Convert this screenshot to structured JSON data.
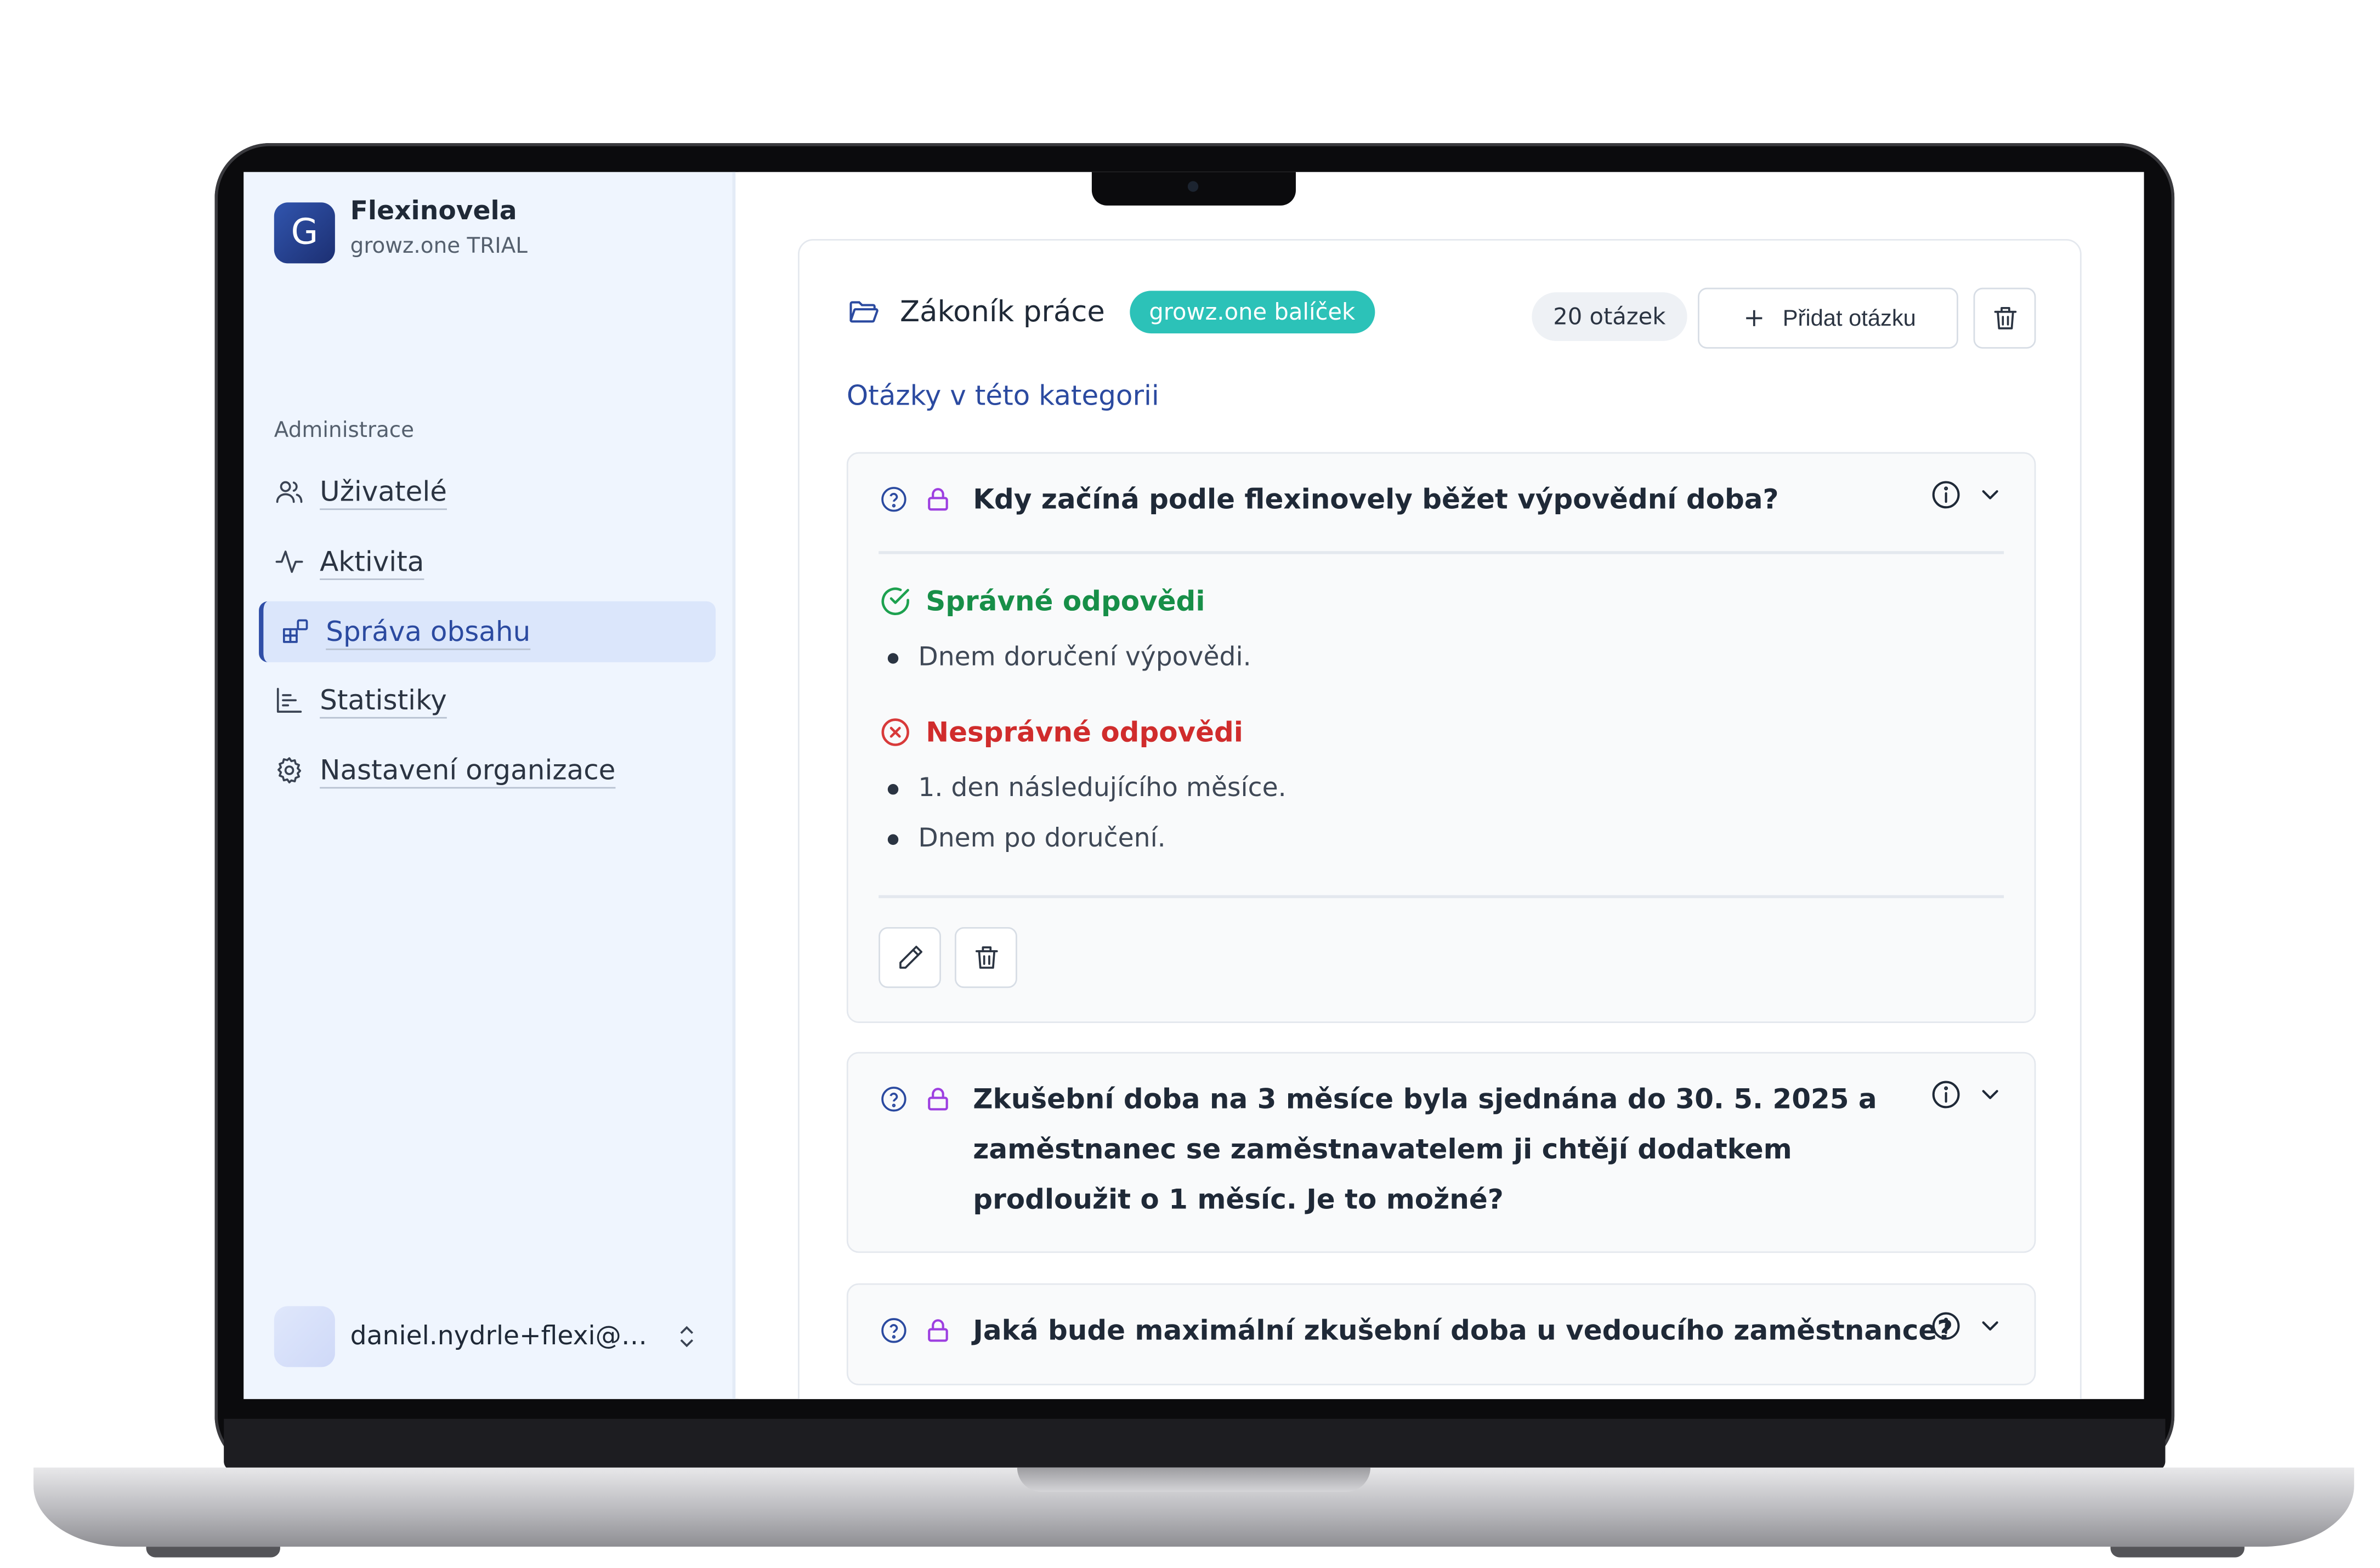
{
  "sidebar": {
    "org_initial": "G",
    "org_name": "Flexinovela",
    "org_plan": "growz.one TRIAL",
    "section_label": "Administrace",
    "items": [
      {
        "label": "Uživatelé",
        "icon": "users-icon"
      },
      {
        "label": "Aktivita",
        "icon": "activity-icon"
      },
      {
        "label": "Správa obsahu",
        "icon": "content-blocks-icon",
        "active": true
      },
      {
        "label": "Statistiky",
        "icon": "bar-chart-icon"
      },
      {
        "label": "Nastavení organizace",
        "icon": "gear-icon"
      }
    ],
    "user_email": "daniel.nydrle+flexi@g..."
  },
  "category": {
    "title": "Zákoník práce",
    "badge": "growz.one balíček",
    "count_label": "20 otázek",
    "add_question_label": "Přidat otázku",
    "subtitle": "Otázky v této kategorii"
  },
  "questions": [
    {
      "text": "Kdy začíná podle flexinovely běžet výpovědní doba?",
      "correct_label": "Správné odpovědi",
      "correct": [
        "Dnem doručení výpovědi."
      ],
      "incorrect_label": "Nesprávné odpovědi",
      "incorrect": [
        "1. den následujícího měsíce.",
        "Dnem po doručení."
      ]
    },
    {
      "text": "Zkušební doba na 3 měsíce byla sjednána do 30. 5. 2025 a zaměstnanec se zaměstnavatelem ji chtějí dodatkem prodloužit o 1 měsíc. Je to možné?"
    },
    {
      "text": "Jaká bude maximální zkušební doba u vedoucího zaměstnance?"
    }
  ],
  "colors": {
    "accent": "#2b4aa0",
    "badge": "#2cc2b8",
    "correct": "#178f48",
    "incorrect": "#d02c2c",
    "lock": "#9d3fe0"
  }
}
